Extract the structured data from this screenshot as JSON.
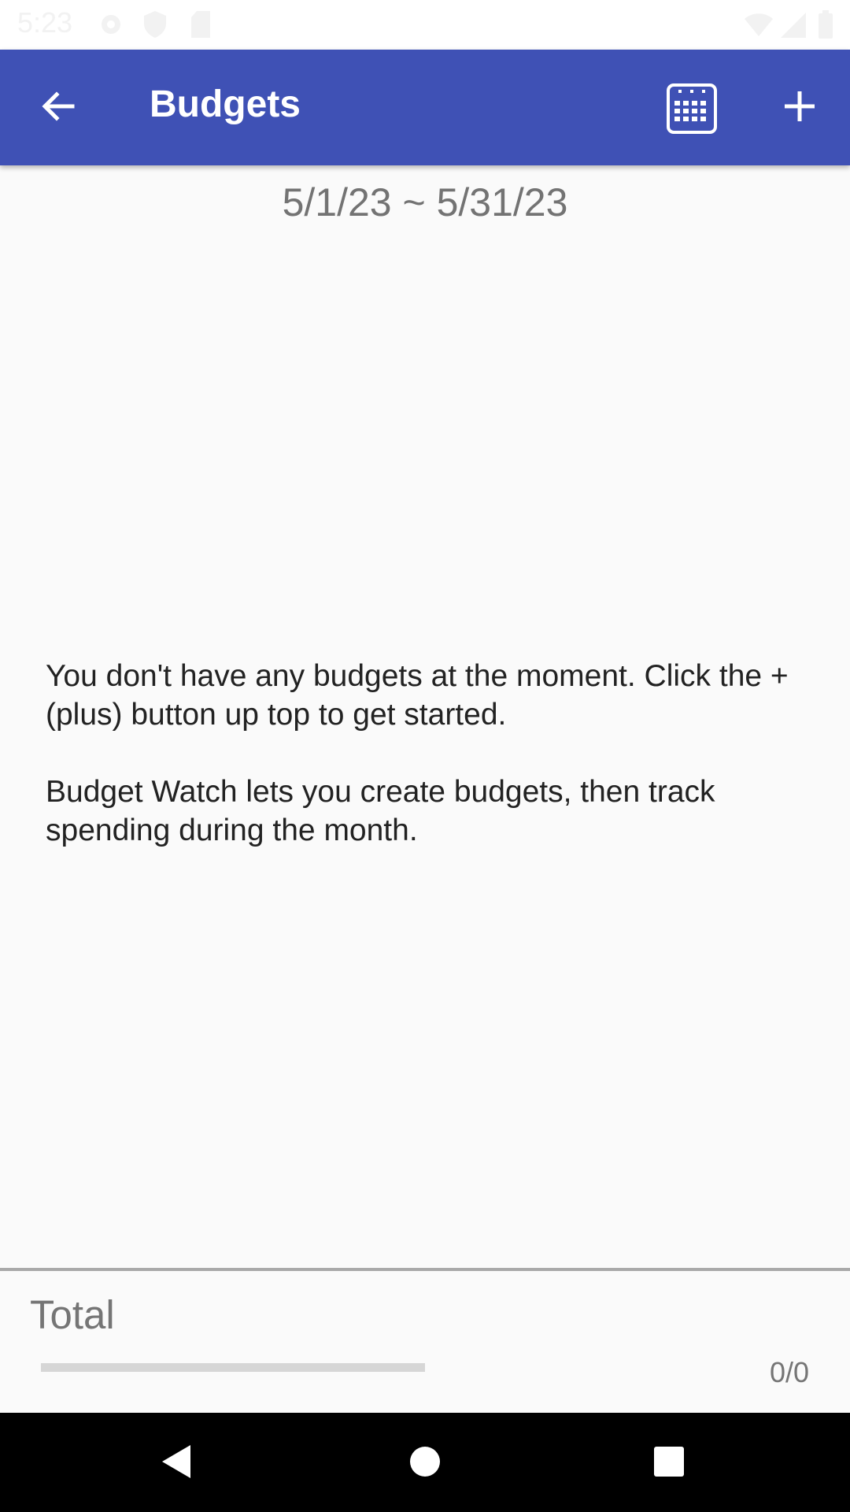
{
  "status_bar": {
    "time": "5:23",
    "icons": [
      "gear-icon",
      "shield-icon",
      "sd-card-icon",
      "wifi-icon",
      "signal-icon",
      "battery-icon"
    ]
  },
  "app_bar": {
    "title": "Budgets",
    "color": "#3f51b5",
    "actions": [
      "back-arrow-icon",
      "calendar-icon",
      "plus-icon"
    ]
  },
  "date_range": "5/1/23 ~ 5/31/23",
  "empty_state": {
    "line1": "You don't have any budgets at the moment. Click the + (plus) button up top to get started.",
    "line2": "Budget Watch lets you create budgets, then track spending during the month."
  },
  "total": {
    "label": "Total",
    "value": "0/0",
    "progress": 0
  },
  "nav_bar": {
    "buttons": [
      "back-triangle-icon",
      "home-circle-icon",
      "recents-square-icon"
    ]
  }
}
